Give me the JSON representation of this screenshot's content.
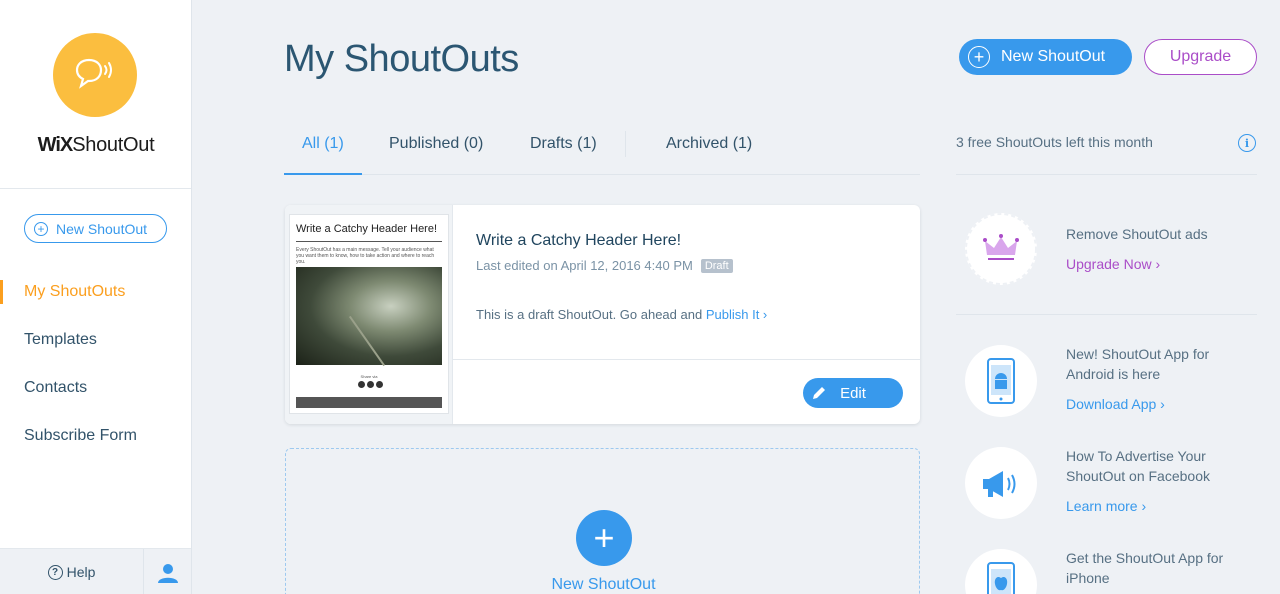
{
  "sidebar": {
    "brand_wix": "WiX",
    "brand_name": "ShoutOut",
    "new_button": "New ShoutOut",
    "items": [
      {
        "label": "My ShoutOuts"
      },
      {
        "label": "Templates"
      },
      {
        "label": "Contacts"
      },
      {
        "label": "Subscribe Form"
      }
    ],
    "help": "Help"
  },
  "header": {
    "title": "My ShoutOuts",
    "new_button": "New ShoutOut",
    "upgrade_button": "Upgrade"
  },
  "tabs": [
    {
      "label": "All (1)"
    },
    {
      "label": "Published (0)"
    },
    {
      "label": "Drafts (1)"
    },
    {
      "label": "Archived (1)"
    }
  ],
  "card": {
    "thumb_title": "Write a Catchy Header Here!",
    "thumb_text": "Every ShoutOut has a main message. Tell your audience what you want them to know, how to take action and where to reach you.",
    "thumb_share": "Share via",
    "title": "Write a Catchy Header Here!",
    "meta": "Last edited on April 12, 2016 4:40 PM",
    "badge": "Draft",
    "draft_text": "This is a draft ShoutOut. Go ahead and",
    "publish_link": "Publish It ›",
    "edit_button": "Edit"
  },
  "new_card": {
    "plus": "+",
    "label": "New ShoutOut"
  },
  "right": {
    "free_left": "3 free ShoutOuts left this month",
    "info": "i",
    "promos": [
      {
        "text": "Remove ShoutOut ads",
        "link": "Upgrade Now ›"
      },
      {
        "text": "New! ShoutOut App for Android is here",
        "link": "Download App ›"
      },
      {
        "text": "How To Advertise Your ShoutOut on Facebook",
        "link": "Learn more ›"
      },
      {
        "text": "Get the ShoutOut App for iPhone",
        "link": ""
      }
    ]
  },
  "colors": {
    "accent": "#3899ec",
    "active_nav": "#fb9f1f",
    "upgrade": "#aa4dc8",
    "logo": "#fbbe3f"
  }
}
